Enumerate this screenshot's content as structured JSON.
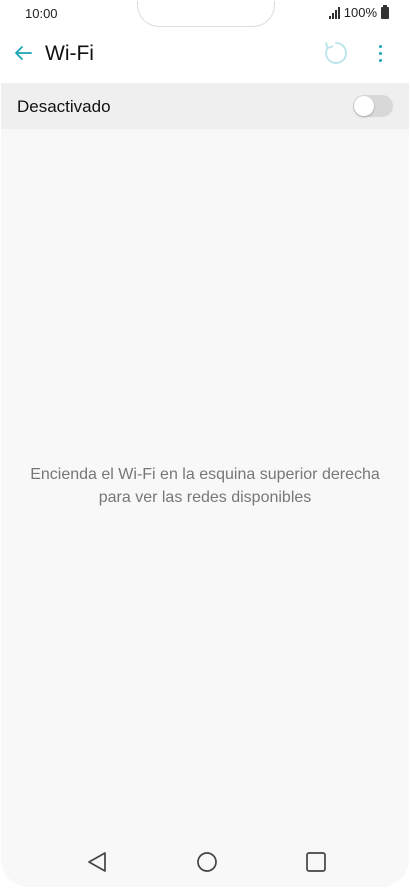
{
  "status_bar": {
    "time": "10:00",
    "battery_percent": "100%"
  },
  "app_bar": {
    "title": "Wi-Fi",
    "accent_color": "#18a4b8"
  },
  "wifi_toggle": {
    "label": "Desactivado",
    "state": "off"
  },
  "empty_state": {
    "line1": "Encienda el Wi-Fi en la esquina superior derecha",
    "line2": "para ver las redes disponibles"
  },
  "icons": {
    "back": "arrow-left-icon",
    "refresh": "refresh-icon",
    "more": "more-vert-icon",
    "nav_back": "triangle-back-icon",
    "nav_home": "circle-home-icon",
    "nav_recent": "square-recent-icon"
  }
}
